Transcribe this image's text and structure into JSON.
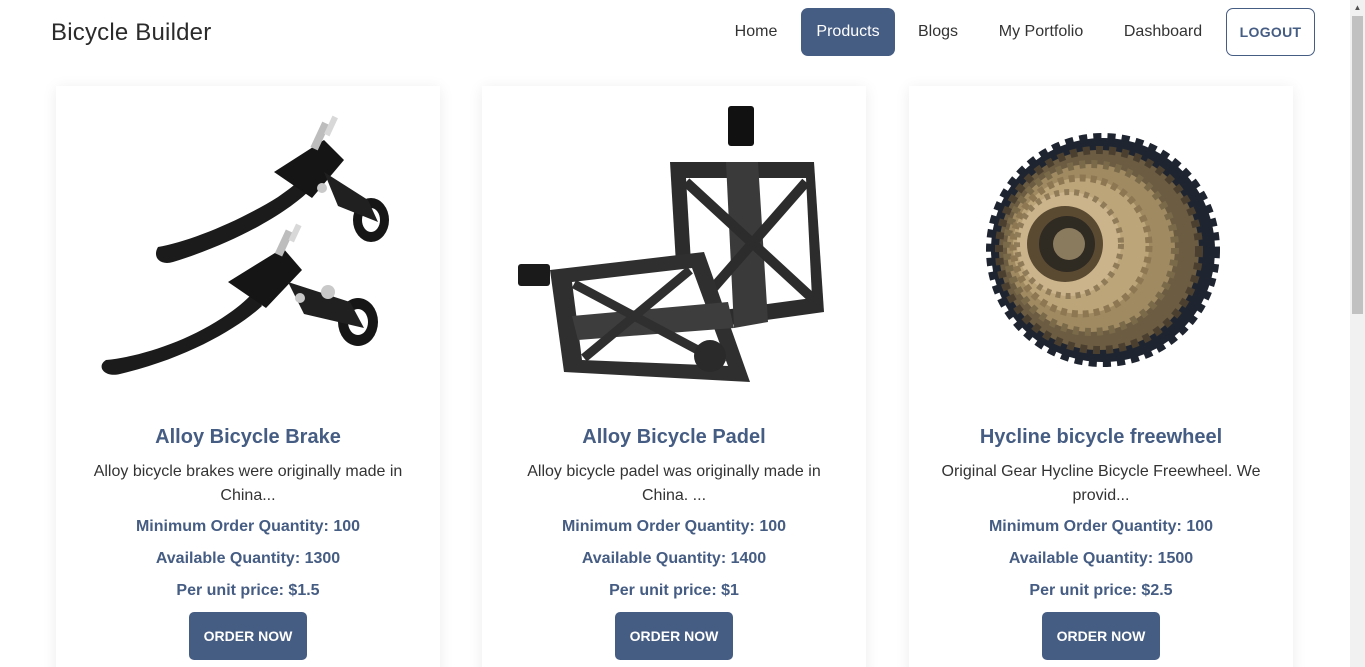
{
  "brand": "Bicycle Builder",
  "nav": {
    "home": "Home",
    "products": "Products",
    "blogs": "Blogs",
    "portfolio": "My Portfolio",
    "dashboard": "Dashboard",
    "logout": "LOGOUT"
  },
  "colors": {
    "primary": "#455c83",
    "card_bg": "#ffffff"
  },
  "products": [
    {
      "title": "Alloy Bicycle Brake",
      "description": "Alloy bicycle brakes were originally made in China...",
      "min_order": "Minimum Order Quantity: 100",
      "available": "Available Quantity: 1300",
      "price": "Per unit price: $1.5",
      "button": "ORDER NOW",
      "image": "bicycle-brake-levers-image"
    },
    {
      "title": "Alloy Bicycle Padel",
      "description": "Alloy bicycle padel was originally made in China. ...",
      "min_order": "Minimum Order Quantity: 100",
      "available": "Available Quantity: 1400",
      "price": "Per unit price: $1",
      "button": "ORDER NOW",
      "image": "bicycle-pedals-image"
    },
    {
      "title": "Hycline bicycle freewheel",
      "description": "Original Gear Hycline Bicycle Freewheel. We provid...",
      "min_order": "Minimum Order Quantity: 100",
      "available": "Available Quantity: 1500",
      "price": "Per unit price: $2.5",
      "button": "ORDER NOW",
      "image": "bicycle-freewheel-image"
    }
  ]
}
